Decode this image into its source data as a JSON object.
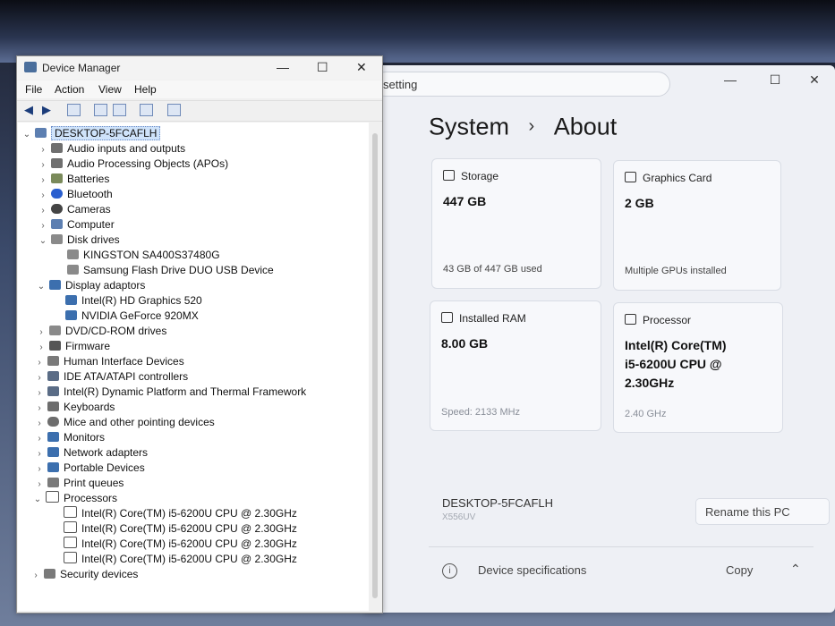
{
  "settings": {
    "search_value": "setting",
    "breadcrumb": {
      "section": "System",
      "page": "About"
    },
    "cards": {
      "storage": {
        "title": "Storage",
        "value": "447 GB",
        "detail": "43 GB of 447 GB used",
        "icon": "storage-icon"
      },
      "graphics": {
        "title": "Graphics Card",
        "value": "2 GB",
        "detail": "Multiple GPUs installed",
        "icon": "graphics-card-icon"
      },
      "ram": {
        "title": "Installed RAM",
        "value": "8.00 GB",
        "detail": "Speed: 2133 MHz",
        "icon": "memory-icon"
      },
      "processor": {
        "title": "Processor",
        "value_line1": "Intel(R) Core(TM)",
        "value_line2": "i5-6200U CPU @",
        "value_line3": "2.30GHz",
        "detail": "2.40 GHz",
        "icon": "processor-icon"
      }
    },
    "device_name": "DESKTOP-5FCAFLH",
    "model": "X556UV",
    "rename_label": "Rename this PC",
    "specs_label": "Device specifications",
    "copy_label": "Copy"
  },
  "device_manager": {
    "title": "Device Manager",
    "menu": [
      "File",
      "Action",
      "View",
      "Help"
    ],
    "tree": {
      "root": "DESKTOP-5FCAFLH",
      "items": [
        "Audio inputs and outputs",
        "Audio Processing Objects (APOs)",
        "Batteries",
        "Bluetooth",
        "Cameras",
        "Computer",
        "Disk drives",
        "KINGSTON SA400S37480G",
        "Samsung Flash Drive DUO USB Device",
        "Display adaptors",
        "Intel(R) HD Graphics 520",
        "NVIDIA GeForce 920MX",
        "DVD/CD-ROM drives",
        "Firmware",
        "Human Interface Devices",
        "IDE ATA/ATAPI controllers",
        "Intel(R) Dynamic Platform and Thermal Framework",
        "Keyboards",
        "Mice and other pointing devices",
        "Monitors",
        "Network adapters",
        "Portable Devices",
        "Print queues",
        "Processors",
        "Intel(R) Core(TM) i5-6200U CPU @ 2.30GHz",
        "Intel(R) Core(TM) i5-6200U CPU @ 2.30GHz",
        "Intel(R) Core(TM) i5-6200U CPU @ 2.30GHz",
        "Intel(R) Core(TM) i5-6200U CPU @ 2.30GHz",
        "Security devices"
      ]
    }
  },
  "colors": {
    "accent": "#1b3c7a",
    "selection": "#cfe3fa",
    "settings_bg": "#eef0f5"
  }
}
